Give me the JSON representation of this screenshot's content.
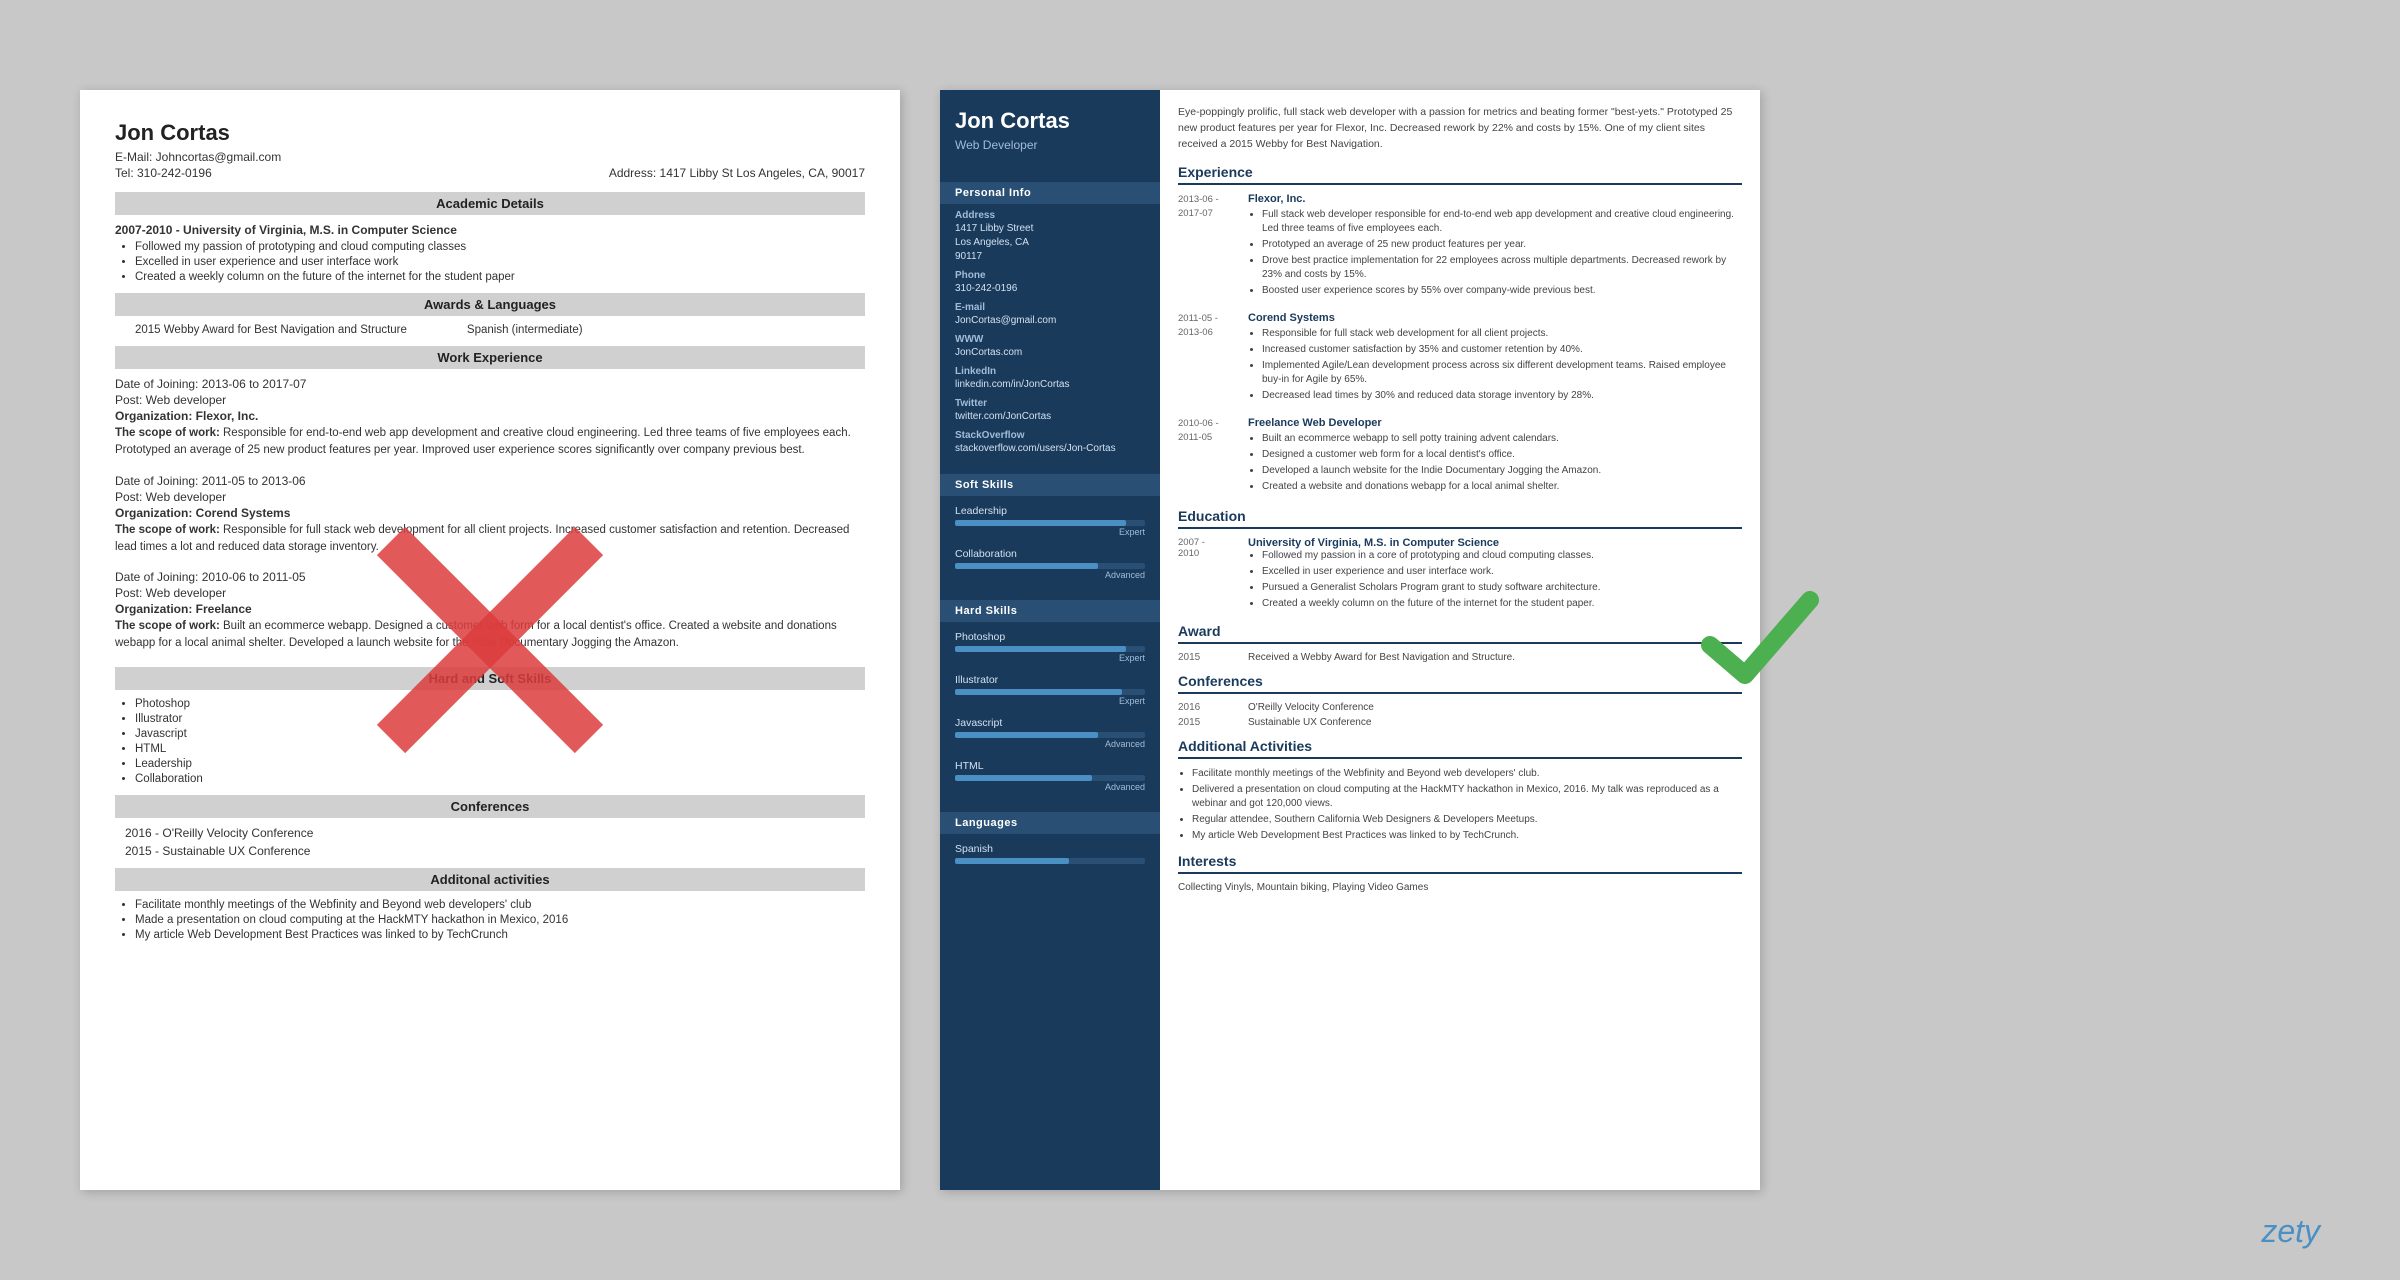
{
  "brand": "zety",
  "left_resume": {
    "name": "Jon Cortas",
    "email": "E-Mail: Johncortas@gmail.com",
    "tel": "Tel: 310-242-0196",
    "address_label": "Address:",
    "address": "1417 Libby St Los Angeles, CA, 90017",
    "sections": {
      "academic": {
        "title": "Academic Details",
        "degree": "2007-2010 - University of Virginia, M.S. in Computer Science",
        "bullets": [
          "Followed my passion of prototyping and cloud computing classes",
          "Excelled in user experience and user interface work",
          "Created a weekly column on the future of the internet for the student paper"
        ]
      },
      "awards": {
        "title": "Awards & Languages",
        "award": "2015 Webby Award for Best Navigation and Structure",
        "language": "Spanish (intermediate)"
      },
      "work": {
        "title": "Work Experience",
        "jobs": [
          {
            "joining": "Date of Joining: 2013-06 to 2017-07",
            "post": "Post: Web developer",
            "org": "Organization: Flexor, Inc.",
            "scope_label": "The scope of work:",
            "scope": "Responsible for end-to-end web app development and creative cloud engineering. Led three teams of five employees each. Prototyped an average of 25 new product features per year. Improved user experience scores significantly over company previous best."
          },
          {
            "joining": "Date of Joining: 2011-05 to 2013-06",
            "post": "Post: Web developer",
            "org": "Organization: Corend Systems",
            "scope_label": "The scope of work:",
            "scope": "Responsible for full stack web development for all client projects. Increased customer satisfaction and retention. Decreased lead times a lot and reduced data storage inventory."
          },
          {
            "joining": "Date of Joining: 2010-06 to 2011-05",
            "post": "Post: Web developer",
            "org": "Organization: Freelance",
            "scope_label": "The scope of work:",
            "scope": "Built an ecommerce webapp. Designed a customer web form for a local dentist's office. Created a website and donations webapp for a local animal shelter. Developed a launch website for the Indie Documentary Jogging the Amazon."
          }
        ]
      },
      "skills": {
        "title": "Hard and Soft Skills",
        "items": [
          "Photoshop",
          "Illustrator",
          "Javascript",
          "HTML",
          "Leadership",
          "Collaboration"
        ]
      },
      "conferences": {
        "title": "Conferences",
        "items": [
          "2016 - O'Reilly Velocity Conference",
          "2015 - Sustainable UX Conference"
        ]
      },
      "activities": {
        "title": "Additonal activities",
        "bullets": [
          "Facilitate monthly meetings of the Webfinity and Beyond web developers' club",
          "Made a presentation on cloud computing at the HackMTY hackathon in Mexico, 2016",
          "My article Web Development Best Practices was linked to by TechCrunch"
        ]
      }
    }
  },
  "right_resume": {
    "name": "Jon Cortas",
    "title": "Web Developer",
    "summary": "Eye-poppingly prolific, full stack web developer with a passion for metrics and beating former \"best-yets.\" Prototyped 25 new product features per year for Flexor, Inc. Decreased rework by 22% and costs by 15%. One of my client sites received a 2015 Webby for Best Navigation.",
    "personal_info": {
      "section_title": "Personal Info",
      "address_label": "Address",
      "address": "1417 Libby Street\nLos Angeles, CA\n90117",
      "phone_label": "Phone",
      "phone": "310-242-0196",
      "email_label": "E-mail",
      "email": "JonCortas@gmail.com",
      "www_label": "WWW",
      "www": "JonCortas.com",
      "linkedin_label": "LinkedIn",
      "linkedin": "linkedin.com/in/JonCortas",
      "twitter_label": "Twitter",
      "twitter": "twitter.com/JonCortas",
      "stackoverflow_label": "StackOverflow",
      "stackoverflow": "stackoverflow.com/users/Jon-Cortas"
    },
    "soft_skills": {
      "section_title": "Soft Skills",
      "skills": [
        {
          "name": "Leadership",
          "level": 90,
          "label": "Expert"
        },
        {
          "name": "Collaboration",
          "level": 75,
          "label": "Advanced"
        }
      ]
    },
    "hard_skills": {
      "section_title": "Hard Skills",
      "skills": [
        {
          "name": "Photoshop",
          "level": 90,
          "label": "Expert"
        },
        {
          "name": "Illustrator",
          "level": 88,
          "label": "Expert"
        },
        {
          "name": "Javascript",
          "level": 75,
          "label": "Advanced"
        },
        {
          "name": "HTML",
          "level": 72,
          "label": "Advanced"
        }
      ]
    },
    "languages": {
      "section_title": "Languages",
      "items": [
        {
          "name": "Spanish",
          "level": 60,
          "label": ""
        }
      ]
    },
    "experience": {
      "section_title": "Experience",
      "jobs": [
        {
          "dates": "2013-06 -\n2017-07",
          "company": "Flexor, Inc.",
          "bullets": [
            "Full stack web developer responsible for end-to-end web app development and creative cloud engineering. Led three teams of five employees each.",
            "Prototyped an average of 25 new product features per year.",
            "Drove best practice implementation for 22 employees across multiple departments. Decreased rework by 23% and costs by 15%.",
            "Boosted user experience scores by 55% over company-wide previous best."
          ]
        },
        {
          "dates": "2011-05 -\n2013-06",
          "company": "Corend Systems",
          "bullets": [
            "Responsible for full stack web development for all client projects.",
            "Increased customer satisfaction by 35% and customer retention by 40%.",
            "Implemented Agile/Lean development process across six different development teams. Raised employee buy-in for Agile by 65%.",
            "Decreased lead times by 30% and reduced data storage inventory by 28%."
          ]
        },
        {
          "dates": "2010-06 -\n2011-05",
          "company": "Freelance Web Developer",
          "bullets": [
            "Built an ecommerce webapp to sell potty training advent calendars.",
            "Designed a customer web form for a local dentist's office.",
            "Developed a launch website for the Indie Documentary Jogging the Amazon.",
            "Created a website and donations webapp for a local animal shelter."
          ]
        }
      ]
    },
    "education": {
      "section_title": "Education",
      "entries": [
        {
          "dates": "2007 -\n2010",
          "degree": "University of Virginia, M.S. in Computer Science",
          "bullets": [
            "Followed my passion in a core of prototyping and cloud computing classes.",
            "Excelled in user experience and user interface work.",
            "Pursued a Generalist Scholars Program grant to study software architecture.",
            "Created a weekly column on the future of the internet for the student paper."
          ]
        }
      ]
    },
    "award": {
      "section_title": "Award",
      "year": "2015",
      "text": "Received a Webby Award for Best Navigation and Structure."
    },
    "conferences": {
      "section_title": "Conferences",
      "items": [
        {
          "year": "2016",
          "name": "O'Reilly Velocity Conference"
        },
        {
          "year": "2015",
          "name": "Sustainable UX Conference"
        }
      ]
    },
    "activities": {
      "section_title": "Additional Activities",
      "bullets": [
        "Facilitate monthly meetings of the Webfinity and Beyond web developers' club.",
        "Delivered a presentation on cloud computing at the HackMTY hackathon in Mexico, 2016. My talk was reproduced as a webinar and got 120,000 views.",
        "Regular attendee, Southern California Web Designers & Developers Meetups.",
        "My article Web Development Best Practices was linked to by TechCrunch."
      ]
    },
    "interests": {
      "section_title": "Interests",
      "text": "Collecting Vinyls, Mountain biking, Playing Video Games"
    }
  }
}
